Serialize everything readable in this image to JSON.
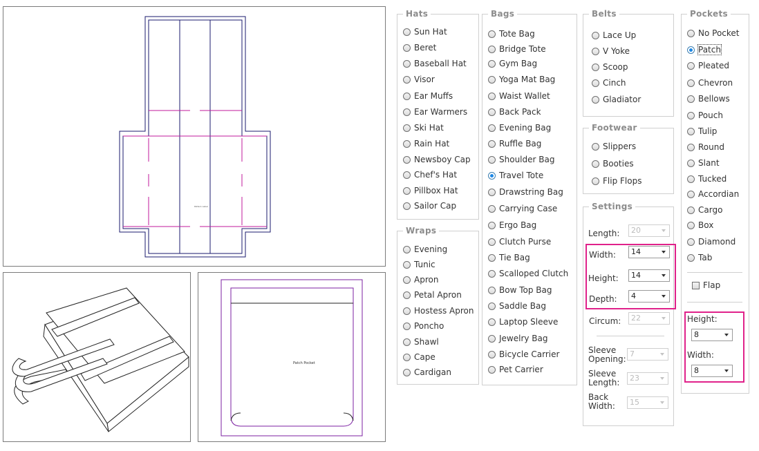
{
  "preview": {
    "pattern_label": "Pattern Label",
    "pocket_label": "Patch Pocket"
  },
  "hats": {
    "legend": "Hats",
    "items": [
      "Sun Hat",
      "Beret",
      "Baseball Hat",
      "Visor",
      "Ear Muffs",
      "Ear Warmers",
      "Ski Hat",
      "Rain Hat",
      "Newsboy Cap",
      "Chef's Hat",
      "Pillbox Hat",
      "Sailor Cap"
    ]
  },
  "wraps": {
    "legend": "Wraps",
    "items": [
      "Evening",
      "Tunic",
      "Apron",
      "Petal Apron",
      "Hostess Apron",
      "Poncho",
      "Shawl",
      "Cape",
      "Cardigan"
    ]
  },
  "bags": {
    "legend": "Bags",
    "selected": "Travel Tote",
    "items": [
      "Tote Bag",
      "Bridge Tote",
      "Gym Bag",
      "Yoga Mat Bag",
      "Waist Wallet",
      "Back Pack",
      "Evening Bag",
      "Ruffle Bag",
      "Shoulder Bag",
      "Travel Tote",
      "Drawstring Bag",
      "Carrying Case",
      "Ergo Bag",
      "Clutch Purse",
      "Tie Bag",
      "Scalloped Clutch",
      "Bow Top Bag",
      "Saddle Bag",
      "Laptop Sleeve",
      "Jewelry Bag",
      "Bicycle Carrier",
      "Pet Carrier"
    ]
  },
  "belts": {
    "legend": "Belts",
    "items": [
      "Lace Up",
      "V Yoke",
      "Scoop",
      "Cinch",
      "Gladiator"
    ]
  },
  "footwear": {
    "legend": "Footwear",
    "items": [
      "Slippers",
      "Booties",
      "Flip Flops"
    ]
  },
  "settings": {
    "legend": "Settings",
    "length_label": "Length:",
    "length_value": "20",
    "width_label": "Width:",
    "width_value": "14",
    "height_label": "Height:",
    "height_value": "14",
    "depth_label": "Depth:",
    "depth_value": "4",
    "circum_label": "Circum:",
    "circum_value": "22",
    "sleeve_opening_label_1": "Sleeve",
    "sleeve_opening_label_2": "Opening:",
    "sleeve_opening_value": "7",
    "sleeve_length_label_1": "Sleeve",
    "sleeve_length_label_2": "Length:",
    "sleeve_length_value": "23",
    "back_width_label_1": "Back",
    "back_width_label_2": "Width:",
    "back_width_value": "15"
  },
  "pockets": {
    "legend": "Pockets",
    "selected": "Patch",
    "items": [
      "No Pocket",
      "Patch",
      "Pleated",
      "Chevron",
      "Bellows",
      "Pouch",
      "Tulip",
      "Round",
      "Slant",
      "Tucked",
      "Accordian",
      "Cargo",
      "Box",
      "Diamond",
      "Tab"
    ],
    "flap_label": "Flap",
    "height_label": "Height:",
    "height_value": "8",
    "width_label": "Width:",
    "width_value": "8"
  },
  "colors": {
    "accent": "#e0218a",
    "radio_selected": "#1e88e5",
    "pattern_outline": "#1a1a6e",
    "fold_line": "#c2189b"
  }
}
